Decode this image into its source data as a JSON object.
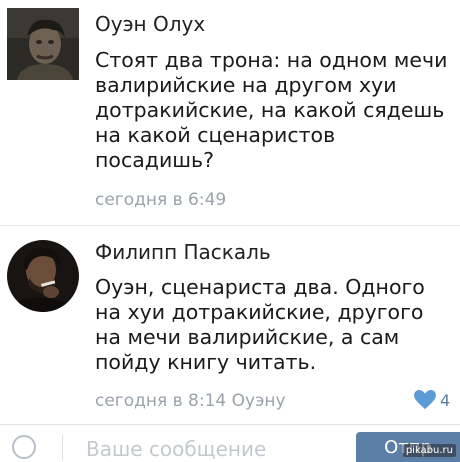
{
  "comments": [
    {
      "author": "Оуэн Олух",
      "lines": [
        "Стоят два трона: на одном мечи",
        "валирийские на другом хуи",
        "дотракийские, на какой сядешь",
        "на какой сценаристов",
        "посадишь?"
      ],
      "time": "сегодня в 6:49"
    },
    {
      "author": "Филипп Паскаль",
      "lines": [
        "Оуэн, сценариста два. Одного",
        "на хуи дотракийские, другого",
        "на мечи валирийские, а сам",
        "пойду книгу читать."
      ],
      "time": "сегодня в 8:14 Оуэну",
      "likes": "4"
    }
  ],
  "composer": {
    "placeholder": "Ваше сообщение",
    "send_label": "Отпр"
  },
  "watermark": "pikabu.ru",
  "colors": {
    "accent": "#5b7fa6",
    "like": "#5d9bd6",
    "meta": "#9aa2ab"
  }
}
